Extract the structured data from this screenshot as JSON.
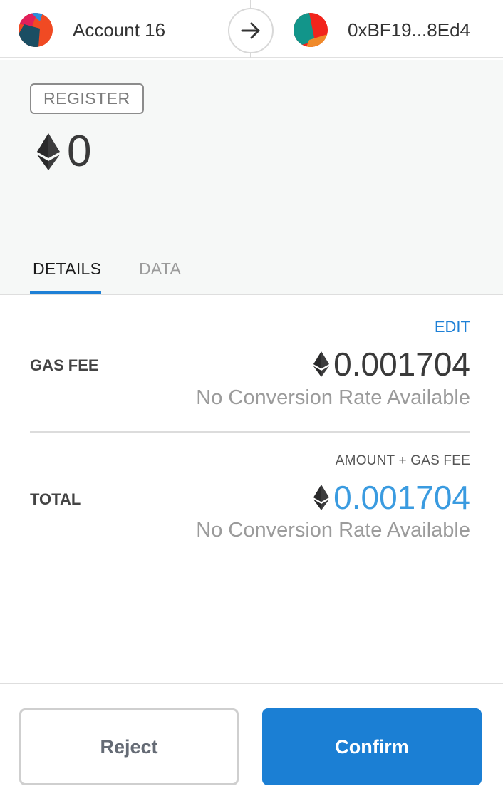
{
  "colors": {
    "accent": "#1e80d6",
    "summary_bg": "#f6f8f7",
    "total_value": "#3a9be0",
    "muted_text": "#9b9b9b"
  },
  "header": {
    "from_account": {
      "name": "Account 16",
      "avatar_icon": "identicon"
    },
    "direction_icon": "arrow-right-icon",
    "to_account": {
      "name": "0xBF19...8Ed4",
      "avatar_icon": "identicon"
    }
  },
  "summary": {
    "method_badge": "REGISTER",
    "currency_icon": "ethereum-icon",
    "value": "0"
  },
  "tabs": [
    {
      "label": "DETAILS",
      "active": true
    },
    {
      "label": "DATA",
      "active": false
    }
  ],
  "details": {
    "edit_label": "EDIT",
    "gas_fee": {
      "label": "GAS FEE",
      "amount": "0.001704",
      "fiat": "No Conversion Rate Available"
    },
    "total": {
      "subheading": "AMOUNT + GAS FEE",
      "label": "TOTAL",
      "amount": "0.001704",
      "fiat": "No Conversion Rate Available"
    }
  },
  "footer": {
    "reject_label": "Reject",
    "confirm_label": "Confirm"
  }
}
